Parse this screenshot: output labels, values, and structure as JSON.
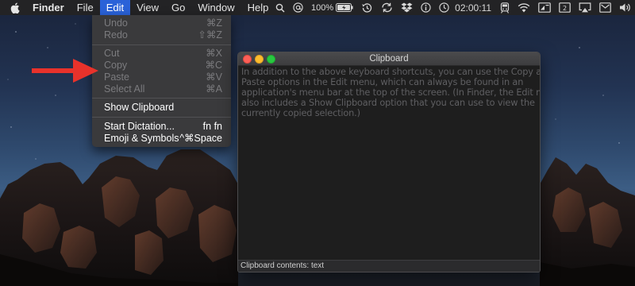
{
  "menubar": {
    "app_name": "Finder",
    "menus": [
      "File",
      "Edit",
      "View",
      "Go",
      "Window",
      "Help"
    ],
    "open_menu": "Edit",
    "battery_text": "100%",
    "clock": "02:00:11"
  },
  "edit_menu": {
    "items": [
      {
        "label": "Undo",
        "shortcut": "⌘Z",
        "enabled": false
      },
      {
        "label": "Redo",
        "shortcut": "⇧⌘Z",
        "enabled": false
      },
      {
        "label": "Cut",
        "shortcut": "⌘X",
        "enabled": false
      },
      {
        "label": "Copy",
        "shortcut": "⌘C",
        "enabled": false
      },
      {
        "label": "Paste",
        "shortcut": "⌘V",
        "enabled": false
      },
      {
        "label": "Select All",
        "shortcut": "⌘A",
        "enabled": false
      },
      {
        "label": "Show Clipboard",
        "shortcut": "",
        "enabled": true
      },
      {
        "label": "Start Dictation...",
        "shortcut": "fn fn",
        "enabled": true
      },
      {
        "label": "Emoji & Symbols",
        "shortcut": "^⌘Space",
        "enabled": true
      }
    ]
  },
  "clipboard_window": {
    "title": "Clipboard",
    "lines": [
      "In addition to the above keyboard shortcuts, you can use the Copy and",
      "Paste options in the Edit menu, which can always be found in an",
      "application's menu bar at the top of the screen. (In Finder, the Edit menu",
      "also includes a Show Clipboard option that you can use to view the",
      "currently copied selection.)"
    ],
    "status": "Clipboard contents: text"
  },
  "colors": {
    "menu_highlight": "#2a62d8",
    "arrow": "#e8322b",
    "close": "#fc5f57",
    "minimize": "#fdbc2e",
    "zoom": "#28c840"
  },
  "icons": {
    "menubar_left": "apple-icon",
    "status": [
      "search-icon",
      "at-sign-icon",
      "battery-icon",
      "time-machine-icon",
      "sync-icon",
      "dropbox-icon",
      "info-icon",
      "clock-icon",
      "train-icon",
      "wifi-icon",
      "display-icon",
      "screen-icon",
      "airplay-icon",
      "message-icon",
      "volume-icon"
    ]
  }
}
